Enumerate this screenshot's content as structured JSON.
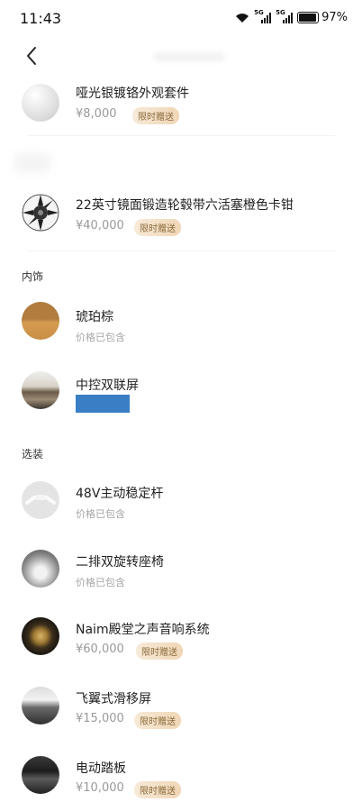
{
  "status": {
    "time": "11:43",
    "signal_1_tag": "5G",
    "signal_2_tag": "5G",
    "battery": "97%"
  },
  "packages": [
    {
      "name": "哑光银镀铬外观套件",
      "price": "¥8,000",
      "badge": "限时赠送",
      "icon": "chrome-trim-swatch"
    },
    {
      "name": "22英寸镜面锻造轮毂带六活塞橙色卡钳",
      "price": "¥40,000",
      "badge": "限时赠送",
      "icon": "wheel-rim"
    }
  ],
  "interior": {
    "title": "内饰",
    "items": [
      {
        "name": "琥珀棕",
        "sub": "价格已包含",
        "icon": "amber-brown-swatch"
      },
      {
        "name": "中控双联屏",
        "icon": "dual-screen-dashboard"
      }
    ]
  },
  "options": {
    "title": "选装",
    "items": [
      {
        "name": "48V主动稳定杆",
        "sub": "价格已包含",
        "icon": "stabilizer-bar"
      },
      {
        "name": "二排双旋转座椅",
        "sub": "价格已包含",
        "icon": "rotating-seats"
      },
      {
        "name": "Naim殿堂之声音响系统",
        "price": "¥60,000",
        "badge": "限时赠送",
        "icon": "speaker"
      },
      {
        "name": "飞翼式滑移屏",
        "price": "¥15,000",
        "badge": "限时赠送",
        "icon": "sliding-screen"
      },
      {
        "name": "电动踏板",
        "price": "¥10,000",
        "badge": "限时赠送",
        "icon": "power-step"
      }
    ]
  },
  "colors": {
    "badge_text": "#8a6a3a",
    "badge_bg": "#f0d6b6",
    "highlight_bar": "#3a7fc5"
  }
}
